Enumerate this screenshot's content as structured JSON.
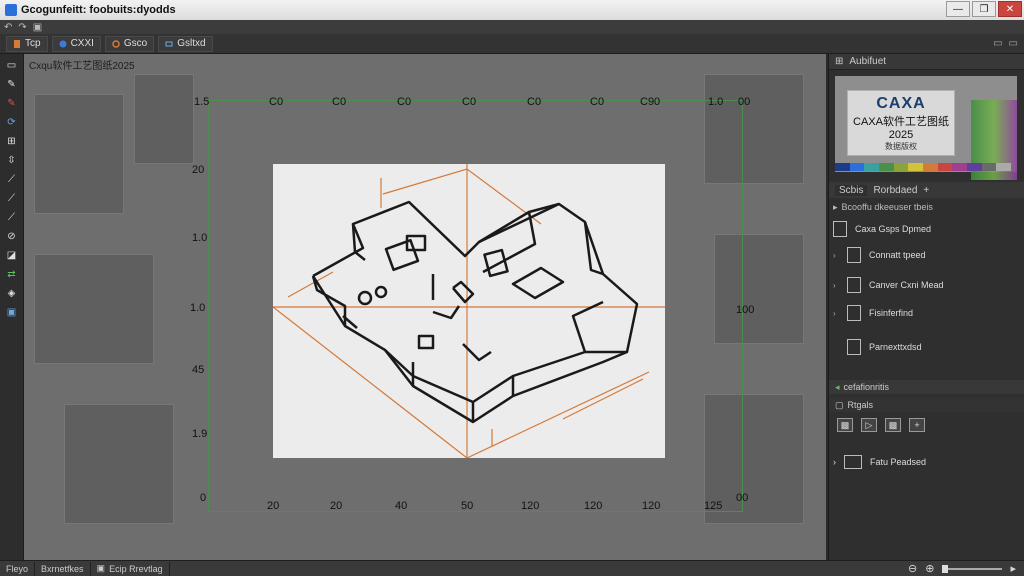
{
  "window": {
    "title": "Gcogunfeitt: foobuits:dyodds",
    "controls": [
      "—",
      "❐",
      "✕"
    ]
  },
  "toolbar": {
    "items": [
      {
        "icon": "file-icon",
        "label": "Tcp"
      },
      {
        "icon": "cloud-icon",
        "label": "CXXI"
      },
      {
        "icon": "gear-icon",
        "label": "Gsco"
      },
      {
        "icon": "link-icon",
        "label": "Gsltxd"
      }
    ]
  },
  "canvas": {
    "title": "Cxqu软件工艺图纸2025",
    "top_labels": [
      "1.5",
      "C0",
      "C0",
      "C0",
      "C0",
      "C0",
      "C0",
      "C90",
      "1.0",
      "00"
    ],
    "left_labels": [
      "20",
      "1.0",
      "1.0",
      "45",
      "1.9",
      "0"
    ],
    "bottom_labels": [
      "20",
      "20",
      "40",
      "50",
      "120",
      "120",
      "120",
      "125",
      "00"
    ],
    "right_label": "100"
  },
  "right_panel": {
    "preview_tab": "Aubifuet",
    "logo": "CAXA",
    "logo_sub": "CAXA软件工艺图纸2025",
    "logo_sub2": "数据版权",
    "tabs": [
      "Scbis",
      "Rorbdaed"
    ],
    "list_header": "Bcooffu dkeeuser tbeis",
    "items": [
      {
        "label": "Caxa Gsps Dpmed"
      },
      {
        "label": "Connatt tpeed"
      },
      {
        "label": "Canver Cxni Mead"
      },
      {
        "label": "Fisinferfind"
      },
      {
        "label": "Parnexttxdsd"
      }
    ],
    "layers_title": "cefafionritis",
    "props_title": "Rtgals",
    "folder_label": "Fatu Peadsed"
  },
  "status": {
    "tabs": [
      "Fleyo",
      "Bxrnetfkes",
      "Ecip Rrevtlag"
    ]
  },
  "colors": {
    "accent": "#d47a3a",
    "grid": "#4f8d4f",
    "background": "#6e6e6e"
  }
}
